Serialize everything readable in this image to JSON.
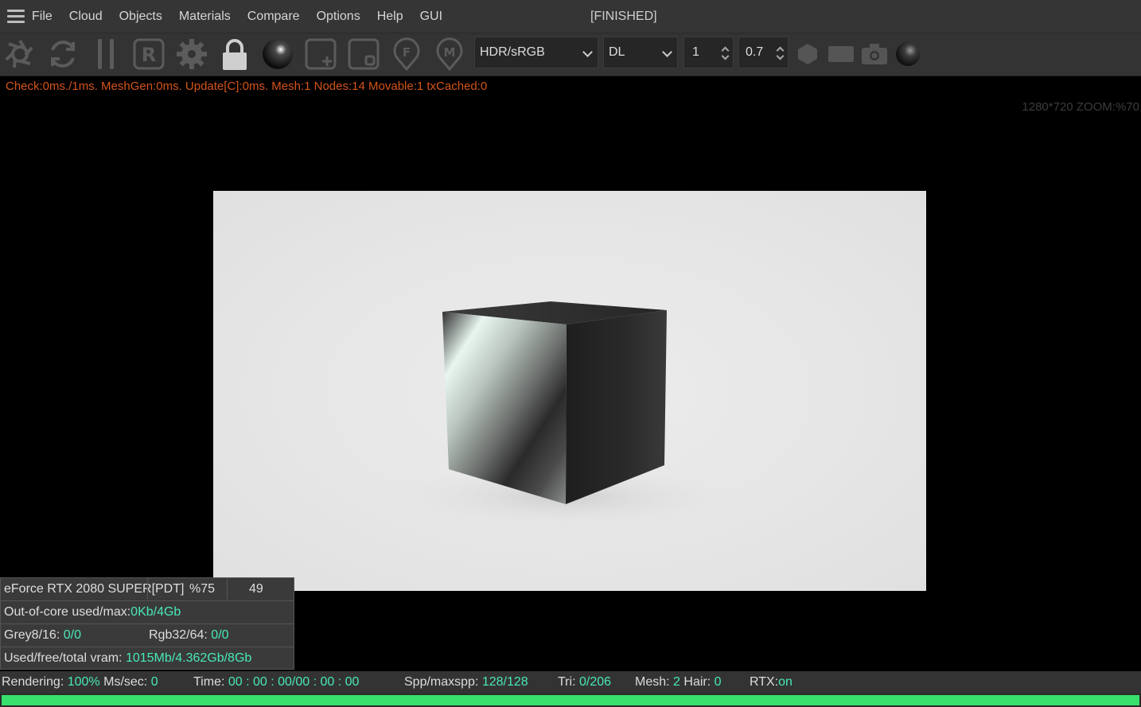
{
  "menu": {
    "items": [
      "File",
      "Cloud",
      "Objects",
      "Materials",
      "Compare",
      "Options",
      "Help",
      "GUI"
    ],
    "status": "[FINISHED]"
  },
  "toolbar": {
    "icons": [
      "aperture-icon",
      "refresh-icon",
      "pause-icon",
      "restart-r-icon",
      "gear-icon",
      "lock-icon",
      "sphere-icon",
      "add-node-icon",
      "node-o-icon",
      "f-pin-icon",
      "m-pin-icon"
    ],
    "tonemap_select": "HDR/sRGB",
    "kernel_select": "DL",
    "spin1_value": "1",
    "spin2_value": "0.7",
    "right_icons": [
      "hexagon-icon",
      "rectangle-icon",
      "camera-icon",
      "sphere-shaded-icon"
    ]
  },
  "viewport": {
    "stats": "Check:0ms./1ms. MeshGen:0ms. Update[C]:0ms. Mesh:1 Nodes:14 Movable:1 txCached:0",
    "zoom_info": "1280*720 ZOOM:%70"
  },
  "gpu_panel": {
    "device_name": "eForce RTX 2080 SUPER[PDT]",
    "device_overlap": "%75",
    "temperature": "49",
    "out_of_core_label": "Out-of-core used/max:",
    "out_of_core_value": "0Kb/4Gb",
    "grey_label": "Grey8/16:",
    "grey_value": "0/0",
    "rgb_label": "Rgb32/64:",
    "rgb_value": "0/0",
    "vram_label": "Used/free/total vram:",
    "vram_value": "1015Mb/4.362Gb/8Gb"
  },
  "status_bar": {
    "rendering_label": "Rendering:",
    "rendering_value": "100%",
    "mssec_label": "Ms/sec:",
    "mssec_value": "0",
    "time_label": "Time:",
    "time_value": "00 : 00 : 00/00 : 00 : 00",
    "spp_label": "Spp/maxspp:",
    "spp_value": "128/128",
    "tri_label": "Tri:",
    "tri_value": "0/206",
    "mesh_label": "Mesh:",
    "mesh_value": "2",
    "hair_label": "Hair:",
    "hair_value": "0",
    "rtx_label": "RTX:",
    "rtx_value": "on"
  },
  "progress": {
    "fraction": 1.0,
    "color": "#37e06a"
  },
  "colors": {
    "accent_value": "#48e8b8",
    "stats_text": "#d4541a"
  }
}
